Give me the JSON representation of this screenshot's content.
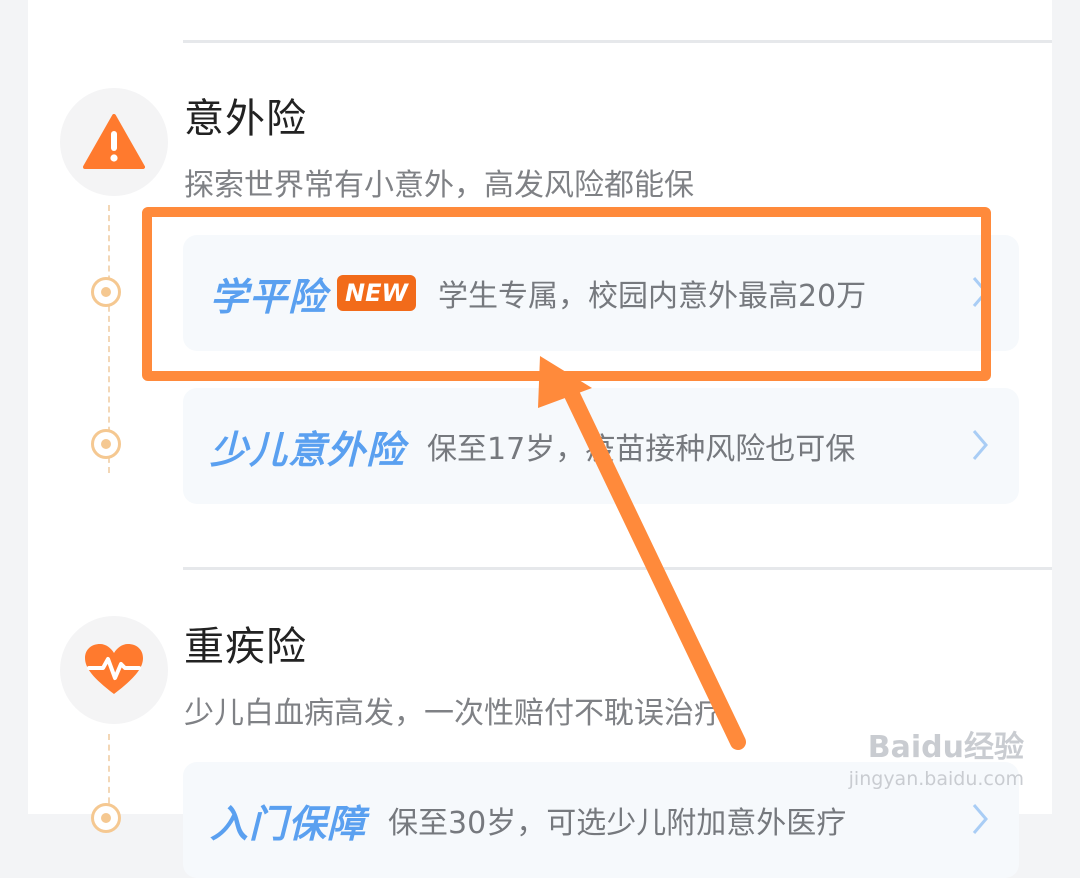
{
  "sections": [
    {
      "title": "意外险",
      "subtitle": "探索世界常有小意外，高发风险都能保",
      "icon": "warning-icon",
      "products": [
        {
          "name": "学平险",
          "badge": "NEW",
          "desc": "学生专属，校园内意外最高20万"
        },
        {
          "name": "少儿意外险",
          "desc": "保至17岁，疫苗接种风险也可保"
        }
      ]
    },
    {
      "title": "重疾险",
      "subtitle": "少儿白血病高发，一次性赔付不耽误治疗",
      "icon": "heartbeat-icon",
      "products": [
        {
          "name": "入门保障",
          "desc": "保至30岁，可选少儿附加意外医疗"
        }
      ]
    }
  ],
  "watermark": {
    "brand": "Baidu经验",
    "url": "jingyan.baidu.com"
  },
  "colors": {
    "accent_orange": "#ff8a3b",
    "product_blue": "#5aa0f0",
    "badge_orange": "#f26b1a"
  }
}
